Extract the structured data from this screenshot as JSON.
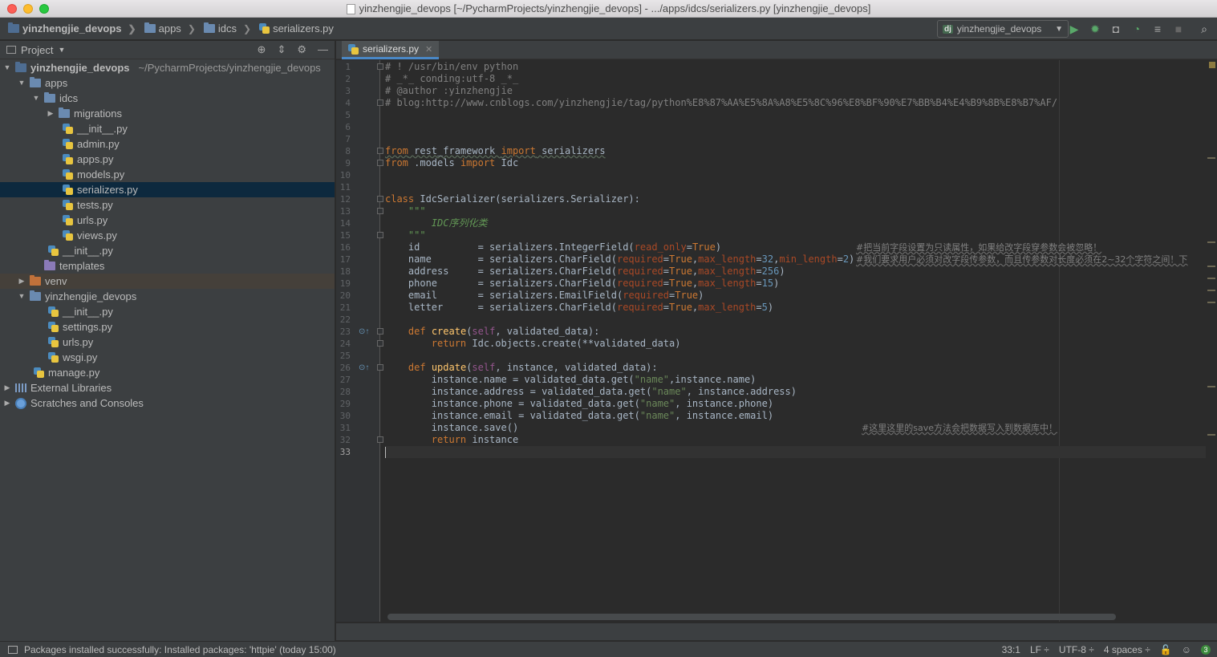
{
  "window": {
    "title": "yinzhengjie_devops [~/PycharmProjects/yinzhengjie_devops] - .../apps/idcs/serializers.py [yinzhengjie_devops]"
  },
  "navbar": {
    "crumbs": [
      "yinzhengjie_devops",
      "apps",
      "idcs",
      "serializers.py"
    ],
    "run_config": "yinzhengjie_devops"
  },
  "project_panel": {
    "title": "Project",
    "tree": [
      {
        "label": "yinzhengjie_devops",
        "path": "~/PycharmProjects/yinzhengjie_devops"
      },
      {
        "label": "apps"
      },
      {
        "label": "idcs"
      },
      {
        "label": "migrations"
      },
      {
        "label": "__init__.py"
      },
      {
        "label": "admin.py"
      },
      {
        "label": "apps.py"
      },
      {
        "label": "models.py"
      },
      {
        "label": "serializers.py"
      },
      {
        "label": "tests.py"
      },
      {
        "label": "urls.py"
      },
      {
        "label": "views.py"
      },
      {
        "label": "__init__.py"
      },
      {
        "label": "templates"
      },
      {
        "label": "venv"
      },
      {
        "label": "yinzhengjie_devops"
      },
      {
        "label": "__init__.py"
      },
      {
        "label": "settings.py"
      },
      {
        "label": "urls.py"
      },
      {
        "label": "wsgi.py"
      },
      {
        "label": "manage.py"
      },
      {
        "label": "External Libraries"
      },
      {
        "label": "Scratches and Consoles"
      }
    ]
  },
  "editor": {
    "tab_label": "serializers.py",
    "line_numbers": [
      "1",
      "2",
      "3",
      "4",
      "5",
      "6",
      "7",
      "8",
      "9",
      "10",
      "11",
      "12",
      "13",
      "14",
      "15",
      "16",
      "17",
      "18",
      "19",
      "20",
      "21",
      "22",
      "23",
      "24",
      "25",
      "26",
      "27",
      "28",
      "29",
      "30",
      "31",
      "32",
      "33"
    ],
    "code": {
      "l1": "# ! /usr/bin/env python",
      "l2": "# _*_ conding:utf-8 _*_",
      "l3": "# @author :yinzhengjie",
      "l4": "# blog:http://www.cnblogs.com/yinzhengjie/tag/python%E8%87%AA%E5%8A%A8%E5%8C%96%E8%BF%90%E7%BB%B4%E4%B9%8B%E8%B7%AF/",
      "l8a": "from",
      "l8b": " rest_framework ",
      "l8c": "import",
      "l8d": " serializers",
      "l9a": "from",
      "l9b": " .models ",
      "l9c": "import",
      "l9d": " Idc",
      "l12a": "class",
      "l12b": " IdcSerializer(serializers.Serializer):",
      "l13": "    \"\"\"",
      "l14": "        IDC序列化类",
      "l15": "    \"\"\"",
      "f_id": "    id          = serializers.IntegerField(",
      "f_id_k": "read_only",
      "f_id_v": "True",
      "f_id_end": ")",
      "note_16": "#把当前字段设置为只读属性，如果给改字段穿参数会被忽略！",
      "f_name": "    name        = serializers.CharField(",
      "k_req": "required",
      "v_true": "True",
      "k_max": "max_length",
      "k_min": "min_length",
      "n32": "32",
      "n2": "2",
      "n256": "256",
      "n15": "15",
      "n5": "5",
      "note_17": "#我们要求用户必须对改字段传参数，而且传参数对长度必须在2~32个字符之间！下",
      "f_address": "    address     = serializers.CharField(",
      "f_phone": "    phone       = serializers.CharField(",
      "f_email": "    email       = serializers.EmailField(",
      "f_letter": "    letter      = serializers.CharField(",
      "def": "def",
      "create_name": "create",
      "self": "self",
      "create_args": ", validated_data):",
      "ret": "return",
      "create_body": " Idc.objects.create(**validated_data)",
      "update_name": "update",
      "update_args": ", instance, validated_data):",
      "u1": "        instance.name = validated_data.get(",
      "u1b": ",instance.name)",
      "u2": "        instance.address = validated_data.get(",
      "u2b": ", instance.address)",
      "u3": "        instance.phone = validated_data.get(",
      "u3b": ", instance.phone)",
      "u4": "        instance.email = validated_data.get(",
      "u4b": ", instance.email)",
      "s_name": "\"name\"",
      "u5": "        instance.save()",
      "note_31": "#这里这里的save方法会把数据写入到数据库中！",
      "u6b": " instance"
    }
  },
  "statusbar": {
    "message": "Packages installed successfully: Installed packages: 'httpie' (today 15:00)",
    "position": "33:1",
    "line_sep": "LF ÷",
    "encoding": "UTF-8 ÷",
    "indent": "4 spaces ÷",
    "badge": "3"
  },
  "colors": {
    "background": "#2b2b2b",
    "panel": "#3c3f41",
    "selection": "#0d293e",
    "keyword": "#cc7832",
    "string": "#6a8759",
    "number": "#6897bb"
  }
}
